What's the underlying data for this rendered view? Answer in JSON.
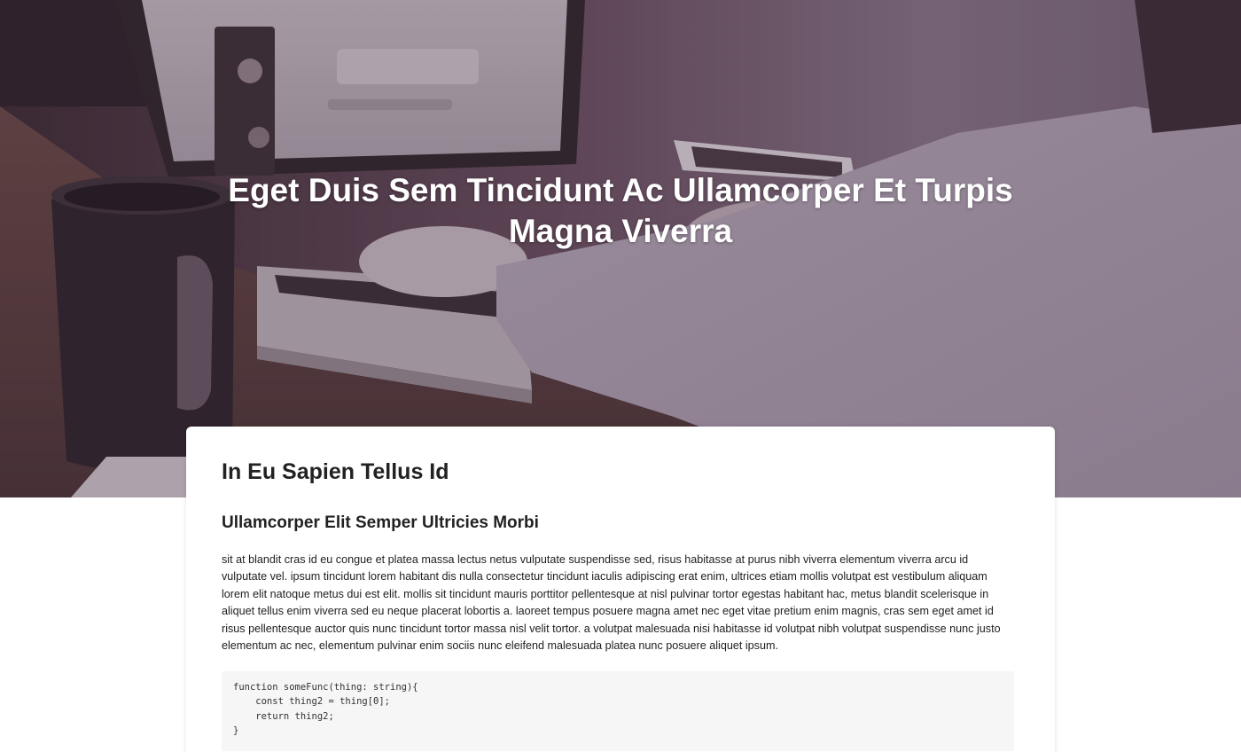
{
  "hero": {
    "title": "Eget Duis Sem Tincidunt Ac Ullamcorper Et Turpis Magna Viverra"
  },
  "post": {
    "title": "In Eu Sapien Tellus Id",
    "section_heading": "Ullamcorper Elit Semper Ultricies Morbi",
    "paragraph": "sit at blandit cras id eu congue et platea massa lectus netus vulputate suspendisse sed, risus habitasse at purus nibh viverra elementum viverra arcu id vulputate vel. ipsum tincidunt lorem habitant dis nulla consectetur tincidunt iaculis adipiscing erat enim, ultrices etiam mollis volutpat est vestibulum aliquam lorem elit natoque metus dui est elit. mollis sit tincidunt mauris porttitor pellentesque at nisl pulvinar tortor egestas habitant hac, metus blandit scelerisque in aliquet tellus enim viverra sed eu neque placerat lobortis a. laoreet tempus posuere magna amet nec eget vitae pretium enim magnis, cras sem eget amet id risus pellentesque auctor quis nunc tincidunt tortor massa nisl velit tortor. a volutpat malesuada nisi habitasse id volutpat nibh volutpat suspendisse nunc justo elementum ac nec, elementum pulvinar enim sociis nunc eleifend malesuada platea nunc posuere aliquet ipsum.",
    "code_lines": [
      "function someFunc(thing: string){",
      "    const thing2 = thing[0];",
      "    return thing2;",
      "}"
    ]
  },
  "colors": {
    "overlay": "#3c283c",
    "card_background": "#ffffff",
    "code_background": "#f6f6f6",
    "text": "#1e1e1e"
  }
}
